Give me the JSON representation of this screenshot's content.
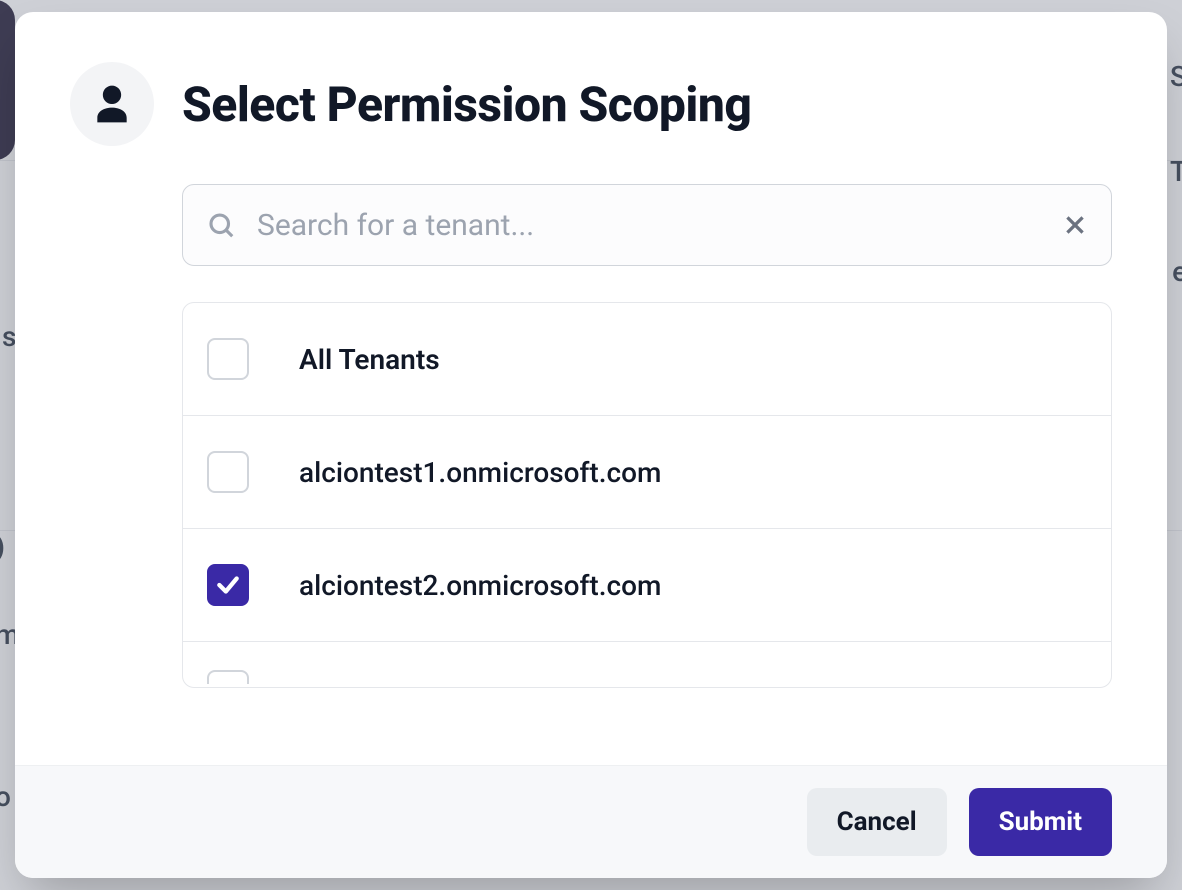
{
  "modal": {
    "title": "Select Permission Scoping",
    "search": {
      "placeholder": "Search for a tenant...",
      "value": ""
    },
    "tenants": [
      {
        "label": "All Tenants",
        "checked": false
      },
      {
        "label": "alciontest1.onmicrosoft.com",
        "checked": false
      },
      {
        "label": "alciontest2.onmicrosoft.com",
        "checked": true
      }
    ],
    "actions": {
      "cancel": "Cancel",
      "submit": "Submit"
    }
  },
  "colors": {
    "primary": "#3a29a6"
  }
}
